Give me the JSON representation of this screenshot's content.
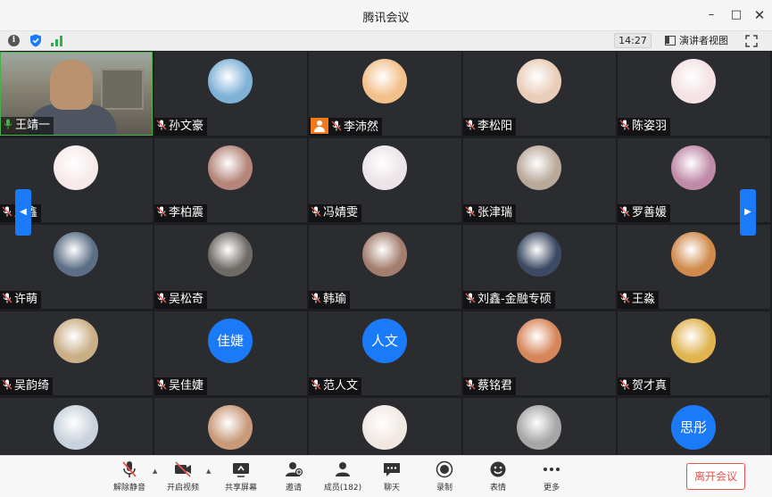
{
  "window": {
    "title": "腾讯会议"
  },
  "infobar": {
    "timer": "14:27",
    "speaker_view_label": "演讲者视图"
  },
  "participants": [
    {
      "name": "王靖一",
      "avatar": "video",
      "color": "#8a7a60"
    },
    {
      "name": "孙文豪",
      "avatar": "photo",
      "color": "#7fb2d6"
    },
    {
      "name": "李沛然",
      "avatar": "photo",
      "color": "#f2c08a",
      "host": true
    },
    {
      "name": "李松阳",
      "avatar": "photo",
      "color": "#e9cdb8"
    },
    {
      "name": "陈姿羽",
      "avatar": "photo",
      "color": "#f4e2e4"
    },
    {
      "name": "周鑫",
      "avatar": "photo",
      "color": "#f7eaea"
    },
    {
      "name": "李柏震",
      "avatar": "photo",
      "color": "#b5857a"
    },
    {
      "name": "冯婧雯",
      "avatar": "photo",
      "color": "#ece4e8"
    },
    {
      "name": "张津瑞",
      "avatar": "photo",
      "color": "#b9a99a"
    },
    {
      "name": "罗善媛",
      "avatar": "photo",
      "color": "#c08aa8"
    },
    {
      "name": "许萌",
      "avatar": "photo",
      "color": "#5c6f86"
    },
    {
      "name": "吴松奇",
      "avatar": "photo",
      "color": "#6e6a66"
    },
    {
      "name": "韩瑜",
      "avatar": "photo",
      "color": "#a37e6e"
    },
    {
      "name": "刘鑫-金融专硕",
      "avatar": "photo",
      "color": "#3c4a64"
    },
    {
      "name": "王淼",
      "avatar": "photo",
      "color": "#d08a4c"
    },
    {
      "name": "吴韵绮",
      "avatar": "photo",
      "color": "#c9ae86"
    },
    {
      "name": "吴佳婕",
      "avatar": "text",
      "avatar_text": "佳婕"
    },
    {
      "name": "范人文",
      "avatar": "text",
      "avatar_text": "人文"
    },
    {
      "name": "蔡铭君",
      "avatar": "photo",
      "color": "#d6865a"
    },
    {
      "name": "贺才真",
      "avatar": "photo",
      "color": "#e0b450"
    },
    {
      "name": "",
      "avatar": "photo",
      "color": "#c9d2dc"
    },
    {
      "name": "",
      "avatar": "photo",
      "color": "#c99a7a"
    },
    {
      "name": "",
      "avatar": "photo",
      "color": "#f2e8e2"
    },
    {
      "name": "",
      "avatar": "photo",
      "color": "#a6a6a6"
    },
    {
      "name": "",
      "avatar": "text",
      "avatar_text": "思彤"
    }
  ],
  "toolbar": {
    "unmute_label": "解除静音",
    "video_label": "开启视频",
    "share_label": "共享屏幕",
    "invite_label": "邀请",
    "members_label": "成员(182)",
    "chat_label": "聊天",
    "record_label": "录制",
    "reaction_label": "表情",
    "more_label": "更多",
    "leave_label": "离开会议"
  },
  "colors": {
    "accent": "#1a7af8",
    "leave": "#e8544d",
    "host_badge": "#f37a1c",
    "active_speaker": "#46b04a"
  }
}
